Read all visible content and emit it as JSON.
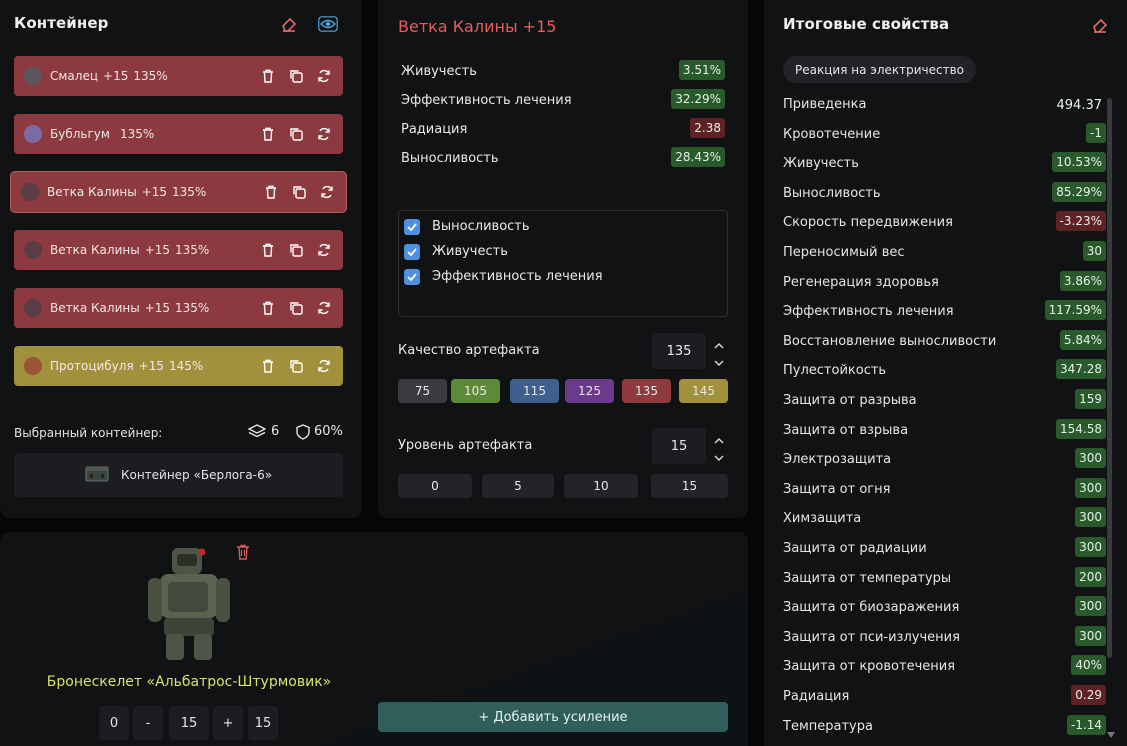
{
  "container": {
    "title": "Контейнер",
    "items": [
      {
        "name": "Смалец",
        "level": "+15",
        "quality": "135%",
        "style": "red",
        "color": "#5b5560"
      },
      {
        "name": "Бубльгум",
        "level": "",
        "quality": "135%",
        "style": "red",
        "color": "#7c6aa6"
      },
      {
        "name": "Ветка Калины",
        "level": "+15",
        "quality": "135%",
        "style": "red",
        "color": "#5a3c44",
        "selected": true
      },
      {
        "name": "Ветка Калины",
        "level": "+15",
        "quality": "135%",
        "style": "red",
        "color": "#5a3c44"
      },
      {
        "name": "Ветка Калины",
        "level": "+15",
        "quality": "135%",
        "style": "red",
        "color": "#5a3c44"
      },
      {
        "name": "Протоцибуля",
        "level": "+15",
        "quality": "145%",
        "style": "yellow",
        "color": "#9a5536"
      }
    ],
    "selected_label": "Выбранный контейнер:",
    "slots": "6",
    "protection": "60%",
    "container_name": "Контейнер «Берлога-6»"
  },
  "artifact": {
    "title": "Ветка Калины +15",
    "stats": [
      {
        "label": "Живучесть",
        "value": "3.51%",
        "tone": "g"
      },
      {
        "label": "Эффективность лечения",
        "value": "32.29%",
        "tone": "g"
      },
      {
        "label": "Радиация",
        "value": "2.38",
        "tone": "r"
      },
      {
        "label": "Выносливость",
        "value": "28.43%",
        "tone": "g"
      }
    ],
    "checks": [
      "Выносливость",
      "Живучесть",
      "Эффективность лечения"
    ],
    "quality_label": "Качество артефакта",
    "quality_value": "135",
    "quality_options": [
      {
        "label": "75",
        "color": "#3a3b3e"
      },
      {
        "label": "105",
        "color": "#5f8a3a"
      },
      {
        "label": "115",
        "color": "#3f5f8f"
      },
      {
        "label": "125",
        "color": "#6b3a8c"
      },
      {
        "label": "135",
        "color": "#8f3a3e"
      },
      {
        "label": "145",
        "color": "#a1913c"
      }
    ],
    "level_label": "Уровень артефакта",
    "level_value": "15",
    "level_options": [
      "0",
      "5",
      "10",
      "15"
    ]
  },
  "armor": {
    "name": "Бронескелет «Альбатрос-Штурмовик»",
    "controls": [
      "0",
      "-",
      "15",
      "+",
      "15"
    ],
    "add_button": "+ Добавить усиление"
  },
  "final": {
    "title": "Итоговые свойства",
    "tag": "Реакция на электричество",
    "stats": [
      {
        "label": "Приведенка",
        "value": "494.37",
        "tone": "plain"
      },
      {
        "label": "Кровотечение",
        "value": "-1",
        "tone": "g"
      },
      {
        "label": "Живучесть",
        "value": "10.53%",
        "tone": "g"
      },
      {
        "label": "Выносливость",
        "value": "85.29%",
        "tone": "g"
      },
      {
        "label": "Скорость передвижения",
        "value": "-3.23%",
        "tone": "r"
      },
      {
        "label": "Переносимый вес",
        "value": "30",
        "tone": "g"
      },
      {
        "label": "Регенерация здоровья",
        "value": "3.86%",
        "tone": "g"
      },
      {
        "label": "Эффективность лечения",
        "value": "117.59%",
        "tone": "g"
      },
      {
        "label": "Восстановление выносливости",
        "value": "5.84%",
        "tone": "g"
      },
      {
        "label": "Пулестойкость",
        "value": "347.28",
        "tone": "g"
      },
      {
        "label": "Защита от разрыва",
        "value": "159",
        "tone": "g"
      },
      {
        "label": "Защита от взрыва",
        "value": "154.58",
        "tone": "g"
      },
      {
        "label": "Электрозащита",
        "value": "300",
        "tone": "g"
      },
      {
        "label": "Защита от огня",
        "value": "300",
        "tone": "g"
      },
      {
        "label": "Химзащита",
        "value": "300",
        "tone": "g"
      },
      {
        "label": "Защита от радиации",
        "value": "300",
        "tone": "g"
      },
      {
        "label": "Защита от температуры",
        "value": "200",
        "tone": "g"
      },
      {
        "label": "Защита от биозаражения",
        "value": "300",
        "tone": "g"
      },
      {
        "label": "Защита от пси-излучения",
        "value": "300",
        "tone": "g"
      },
      {
        "label": "Защита от кровотечения",
        "value": "40%",
        "tone": "g"
      },
      {
        "label": "Радиация",
        "value": "0.29",
        "tone": "r"
      },
      {
        "label": "Температура",
        "value": "-1.14",
        "tone": "g"
      }
    ]
  },
  "colors": {
    "accent_red": "#e05a5a",
    "accent_blue": "#4ea3e0",
    "armor_name": "#d9e36a"
  }
}
